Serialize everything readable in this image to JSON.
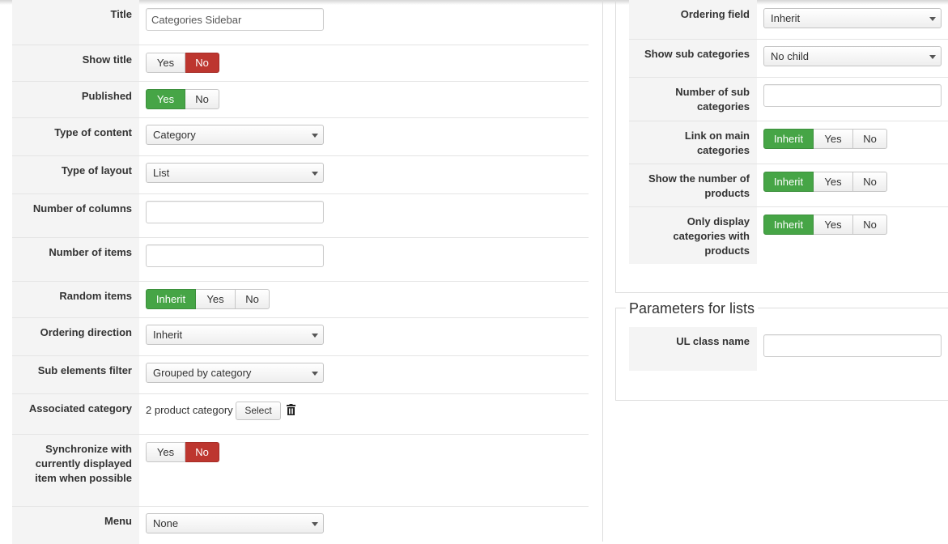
{
  "left": {
    "title": {
      "label": "Title",
      "value": "Categories Sidebar"
    },
    "show_title": {
      "label": "Show title",
      "options": [
        "Yes",
        "No"
      ],
      "selected": "No"
    },
    "published": {
      "label": "Published",
      "options": [
        "Yes",
        "No"
      ],
      "selected": "Yes"
    },
    "type_of_content": {
      "label": "Type of content",
      "value": "Category"
    },
    "type_of_layout": {
      "label": "Type of layout",
      "value": "List"
    },
    "number_of_columns": {
      "label": "Number of columns",
      "value": ""
    },
    "number_of_items": {
      "label": "Number of items",
      "value": ""
    },
    "random_items": {
      "label": "Random items",
      "options": [
        "Inherit",
        "Yes",
        "No"
      ],
      "selected": "Inherit"
    },
    "ordering_direction": {
      "label": "Ordering direction",
      "value": "Inherit"
    },
    "sub_elements_filter": {
      "label": "Sub elements filter",
      "value": "Grouped by category"
    },
    "associated_category": {
      "label": "Associated category",
      "value": "2 product category",
      "select_label": "Select"
    },
    "synchronize": {
      "label": "Synchronize with currently displayed item when possible",
      "options": [
        "Yes",
        "No"
      ],
      "selected": "No"
    },
    "menu": {
      "label": "Menu",
      "value": "None"
    }
  },
  "right": {
    "ordering_field": {
      "label": "Ordering field",
      "value": "Inherit"
    },
    "show_sub_categories": {
      "label": "Show sub categories",
      "value": "No child"
    },
    "number_of_sub_categories": {
      "label": "Number of sub categories",
      "value": ""
    },
    "link_on_main_categories": {
      "label": "Link on main categories",
      "options": [
        "Inherit",
        "Yes",
        "No"
      ],
      "selected": "Inherit"
    },
    "show_number_of_products": {
      "label": "Show the number of products",
      "options": [
        "Inherit",
        "Yes",
        "No"
      ],
      "selected": "Inherit"
    },
    "only_display_with_products": {
      "label": "Only display categories with products",
      "options": [
        "Inherit",
        "Yes",
        "No"
      ],
      "selected": "Inherit"
    }
  },
  "lists": {
    "legend": "Parameters for lists",
    "ul_class_name": {
      "label": "UL class name",
      "value": ""
    }
  },
  "colors": {
    "active_green": "#46a546",
    "active_red": "#bd362f",
    "label_bg": "#f4f4f4"
  },
  "icons": {
    "trash": "trash-icon",
    "caret": "chevron-down-icon"
  }
}
